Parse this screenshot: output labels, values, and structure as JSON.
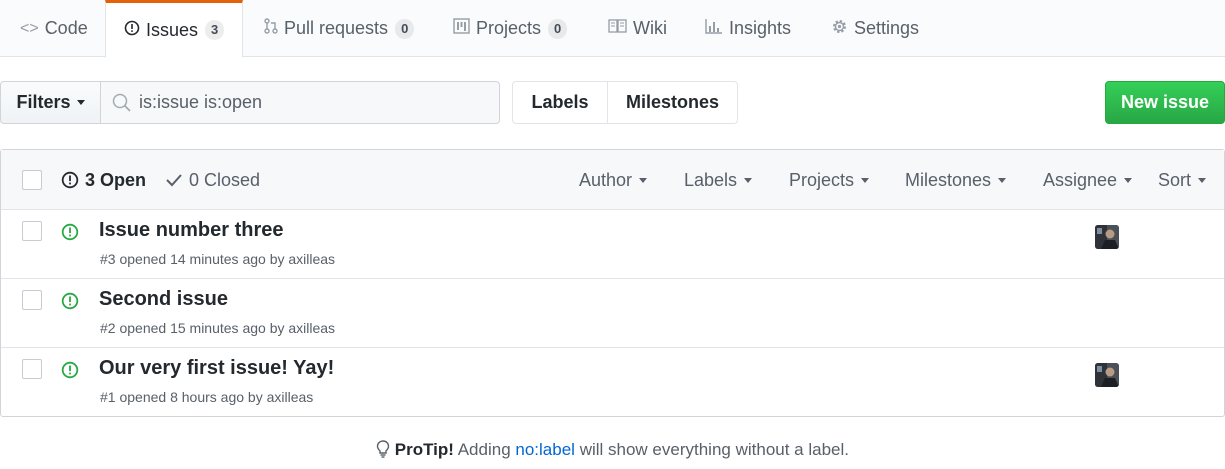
{
  "tabs": [
    {
      "label": "Code",
      "icon": "code-icon"
    },
    {
      "label": "Issues",
      "count": "3",
      "icon": "issue-opened-icon",
      "selected": true
    },
    {
      "label": "Pull requests",
      "count": "0",
      "icon": "git-pull-request-icon"
    },
    {
      "label": "Projects",
      "count": "0",
      "icon": "project-icon"
    },
    {
      "label": "Wiki",
      "icon": "book-icon"
    },
    {
      "label": "Insights",
      "icon": "graph-icon"
    },
    {
      "label": "Settings",
      "icon": "gear-icon"
    }
  ],
  "subnav": {
    "filters_label": "Filters",
    "search_value": "is:issue is:open",
    "labels_label": "Labels",
    "milestones_label": "Milestones",
    "new_issue_label": "New issue"
  },
  "issues_header": {
    "open_label": "3 Open",
    "closed_label": "0 Closed",
    "filters": [
      "Author",
      "Labels",
      "Projects",
      "Milestones",
      "Assignee",
      "Sort"
    ]
  },
  "issues": [
    {
      "title": "Issue number three",
      "meta": "#3 opened 14 minutes ago by axilleas",
      "has_assignee": true
    },
    {
      "title": "Second issue",
      "meta": "#2 opened 15 minutes ago by axilleas",
      "has_assignee": false
    },
    {
      "title": "Our very first issue! Yay!",
      "meta": "#1 opened 8 hours ago by axilleas",
      "has_assignee": true
    }
  ],
  "protip": {
    "bold": "ProTip!",
    "before": "Adding",
    "highlight": "no:label",
    "after": "will show everything without a label."
  },
  "colors": {
    "accent_tab": "#e36209",
    "open_green": "#28a745",
    "new_issue_bg": "#28a745",
    "link_blue": "#0366d6"
  }
}
